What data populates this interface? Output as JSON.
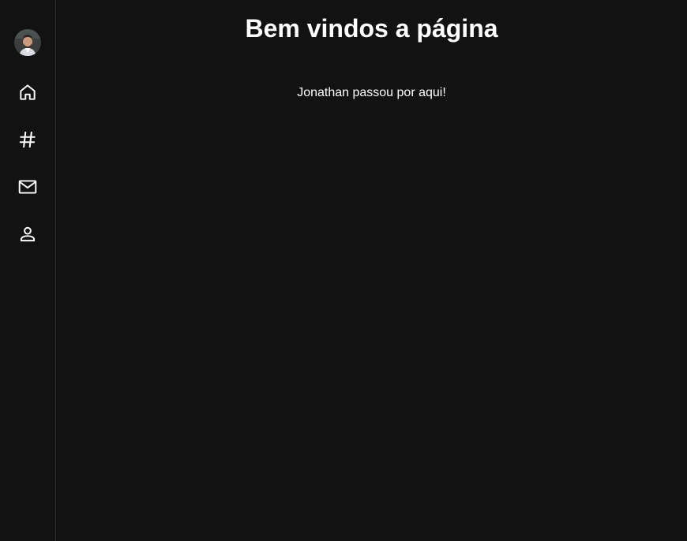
{
  "main": {
    "title": "Bem vindos a página",
    "message": "Jonathan passou por aqui!"
  },
  "sidebar": {
    "items": [
      {
        "icon": "home-icon"
      },
      {
        "icon": "hashtag-icon"
      },
      {
        "icon": "mail-icon"
      },
      {
        "icon": "user-icon"
      }
    ]
  },
  "colors": {
    "background": "#121212",
    "divider": "#2f2f2f",
    "text": "#ffffff"
  }
}
